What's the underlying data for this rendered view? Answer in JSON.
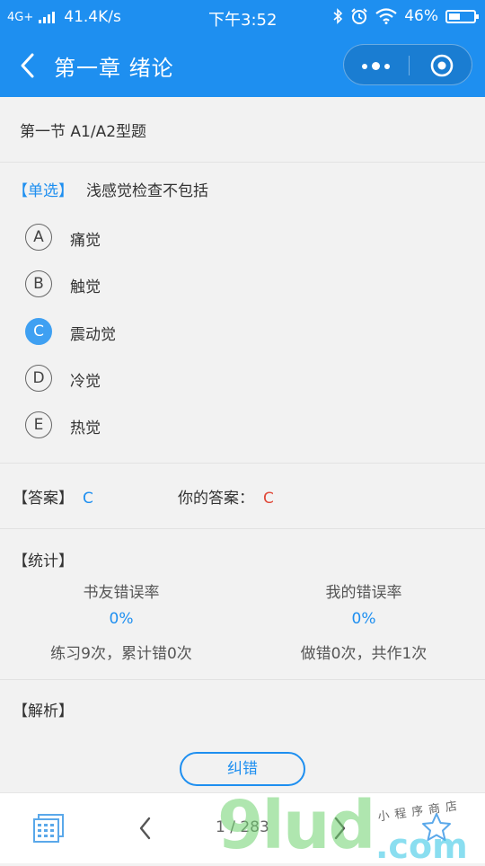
{
  "status_bar": {
    "network": "4G+",
    "speed": "41.4K/s",
    "time": "下午3:52",
    "battery": "46%",
    "battery_level": 0.46
  },
  "nav": {
    "title": "第一章 绪论"
  },
  "section": {
    "title": "第一节 A1/A2型题"
  },
  "question": {
    "type": "【单选】",
    "text": "浅感觉检查不包括",
    "options": [
      {
        "letter": "A",
        "text": "痛觉"
      },
      {
        "letter": "B",
        "text": "触觉"
      },
      {
        "letter": "C",
        "text": "震动觉",
        "selected": true
      },
      {
        "letter": "D",
        "text": "冷觉"
      },
      {
        "letter": "E",
        "text": "热觉"
      }
    ]
  },
  "answer": {
    "label": "【答案】",
    "value": "C",
    "your_label": "你的答案：",
    "your_value": "C"
  },
  "stats": {
    "heading": "【统计】",
    "friends": {
      "label": "书友错误率",
      "rate": "0%",
      "note": "练习9次，累计错0次"
    },
    "mine": {
      "label": "我的错误率",
      "rate": "0%",
      "note": "做错0次，共作1次"
    }
  },
  "analysis": {
    "heading": "【解析】"
  },
  "report_button": {
    "label": "纠错"
  },
  "bottom_bar": {
    "page": "1 / 283"
  },
  "watermark": {
    "brand": "9lud",
    "domain": ".com",
    "tagline": "小程序商店"
  },
  "colors": {
    "primary": "#1e8ff0",
    "selected": "#3fa0f2",
    "user_answer": "#e04a3a"
  },
  "icons": [
    "back-icon",
    "more-icon",
    "close-target-icon",
    "grid-icon",
    "prev-icon",
    "next-icon",
    "star-icon",
    "bluetooth-icon",
    "alarm-icon",
    "wifi-icon",
    "battery-icon",
    "signal-icon"
  ]
}
